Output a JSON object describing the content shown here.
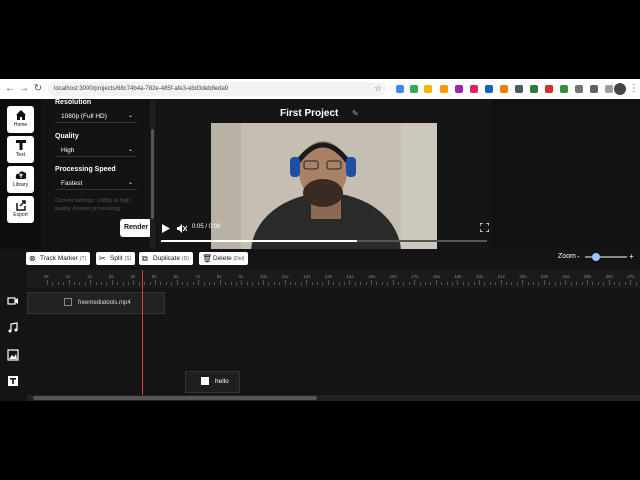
{
  "browser": {
    "url": "localhost:3000/projects/68c74b4a-782e-485f-afe3-ebd3deb8eda9"
  },
  "sidebar": {
    "items": [
      {
        "label": "Home",
        "icon": "home-icon"
      },
      {
        "label": "Text",
        "icon": "text-icon"
      },
      {
        "label": "Library",
        "icon": "cloud-upload-icon"
      },
      {
        "label": "Export",
        "icon": "export-icon"
      }
    ]
  },
  "settings": {
    "resolution_label": "Resolution",
    "resolution_value": "1080p (Full HD)",
    "quality_label": "Quality",
    "quality_value": "High",
    "speed_label": "Processing Speed",
    "speed_value": "Fastest",
    "hint": "Current settings: 1080p at high quality (fastest processing)",
    "render_label": "Render"
  },
  "project": {
    "title": "First Project"
  },
  "player": {
    "time": "0:05 / 0:08",
    "progress": 0.6
  },
  "timeline": {
    "buttons": [
      {
        "label": "Track Marker",
        "shortcut": "(T)",
        "icon": "⊗"
      },
      {
        "label": "Split",
        "shortcut": "(S)",
        "icon": "✂"
      },
      {
        "label": "Duplicate",
        "shortcut": "(D)",
        "icon": "⧉"
      },
      {
        "label": "Delete",
        "shortcut": "(Del)",
        "icon": "🗑"
      }
    ],
    "zoom_label": "Zoom",
    "zoom_minus": "-",
    "zoom_plus": "+",
    "zoom_level": 0.2,
    "ruler_labels": [
      "0s",
      "1s",
      "2s",
      "3s",
      "4s",
      "5s",
      "6s",
      "7s",
      "8s",
      "9s",
      "10s",
      "11s",
      "12s",
      "13s",
      "14s",
      "15s",
      "16s",
      "17s",
      "18s",
      "19s",
      "20s",
      "21s",
      "22s",
      "23s",
      "24s",
      "25s",
      "26s",
      "27s",
      "28s"
    ],
    "video_clip": "freemediatools.mp4",
    "text_clip": "hello"
  },
  "colors": {
    "playhead": "#e53935",
    "app_bg": "#151515"
  }
}
